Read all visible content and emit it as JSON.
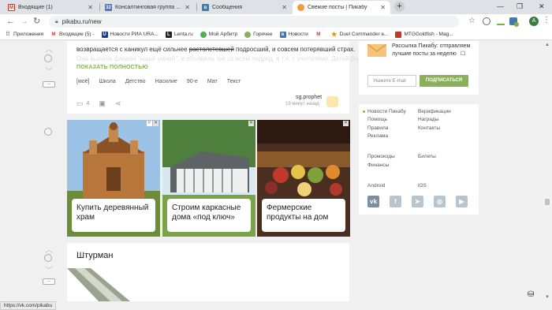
{
  "browser": {
    "tabs": [
      {
        "title": "Входящие (1)",
        "icon": "gmail-icon",
        "active": false
      },
      {
        "title": "Консалтинговая группа \"Партнёр\"",
        "icon": "doc-icon",
        "active": false
      },
      {
        "title": "Сообщения",
        "icon": "vk-icon",
        "active": false
      },
      {
        "title": "Свежие посты | Пикабу",
        "icon": "pikabu-icon",
        "active": true
      }
    ],
    "new_tab": "+",
    "url": "pikabu.ru/new",
    "avatar_letter": "А",
    "bookmarks": [
      {
        "label": "Приложения",
        "icon": "apps-icon"
      },
      {
        "label": "Входящие (5) -",
        "icon": "gmail-icon"
      },
      {
        "label": "Новости РИА URA...",
        "icon": "ura-icon"
      },
      {
        "label": "Lenta.ru",
        "icon": "lenta-icon"
      },
      {
        "label": "Мой Арбитр",
        "icon": "arbitr-icon"
      },
      {
        "label": "Горячее",
        "icon": "pikabu-icon"
      },
      {
        "label": "Новости",
        "icon": "vk-icon"
      },
      {
        "label": "",
        "icon": "gmail-icon"
      },
      {
        "label": "Duel Commander e...",
        "icon": "star-icon"
      },
      {
        "label": "MTGGoldfish - Mag...",
        "icon": "mtg-icon"
      }
    ],
    "status_url": "https://vk.com/pikabu"
  },
  "post": {
    "text_before": "возвращается с каникул ещё сильнее ",
    "text_strike": "растолстевшей",
    "text_after": " подросший, и совсем потерявший страх.",
    "text_faded": "Она выпила флакон \"наше умной\", и объявила так со всем подряд, в т.ч. с учителями. Детей был",
    "show_all": "ПОКАЗАТЬ ПОЛНОСТЬЮ",
    "tags": [
      "[моё]",
      "Школа",
      "Детство",
      "Насилие",
      "90-е",
      "Мат",
      "Текст"
    ],
    "comments": "4",
    "author": "sg.prophet",
    "posted": "19 минут назад"
  },
  "ads": [
    {
      "caption": "Купить деревянный храм"
    },
    {
      "caption": "Строим каркасные дома «под ключ»"
    },
    {
      "caption": "Фермерские продукты на дом"
    }
  ],
  "next_post": {
    "title": "Штурман"
  },
  "sidebar": {
    "subscribe_text": "Рассылка Пикабу: отправляем лучшие посты за неделю",
    "email_placeholder": "Укажите E-mail",
    "subscribe_button": "ПОДПИСАТЬСЯ",
    "links_col1": [
      "Новости Пикабу",
      "Помощь",
      "Правила",
      "Реклама"
    ],
    "links_col2": [
      "Верификации",
      "Награды",
      "Контакты"
    ],
    "links_col1b": [
      "Промокоды",
      "Финансы"
    ],
    "links_col2b": [
      "Билеты"
    ],
    "apps": [
      "Android",
      "iOS"
    ],
    "socials": [
      "vk-icon",
      "facebook-icon",
      "telegram-icon",
      "instagram-icon",
      "youtube-icon"
    ]
  },
  "colors": {
    "accent": "#8ab157",
    "tab_bar": "#dee1e6"
  }
}
